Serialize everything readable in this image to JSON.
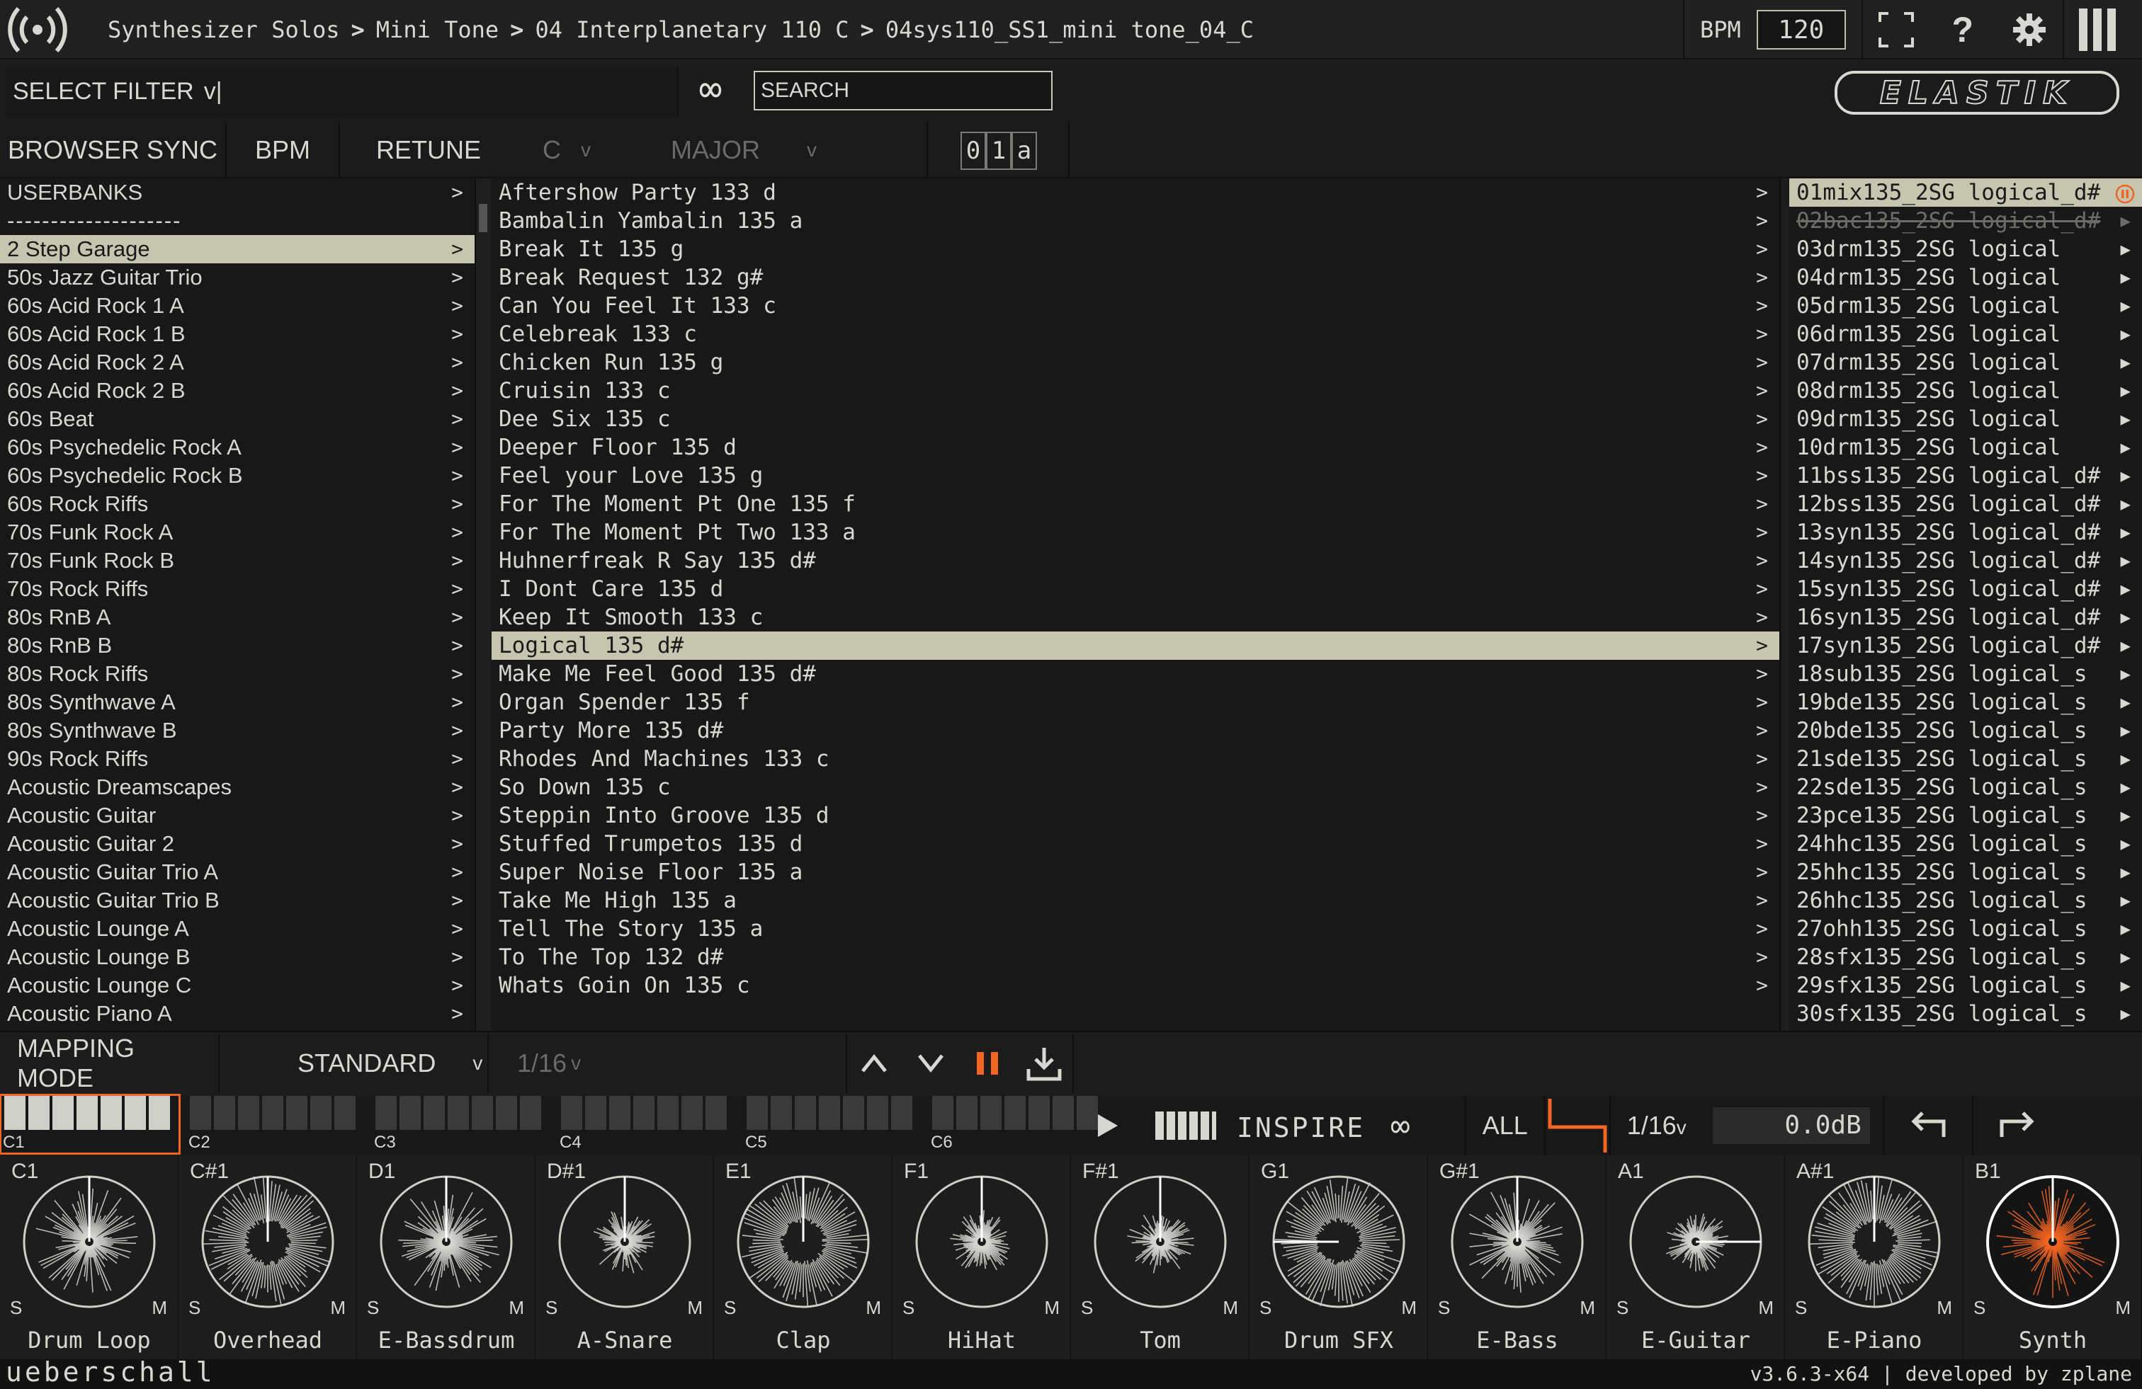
{
  "topbar": {
    "breadcrumb": [
      "Synthesizer Solos",
      "Mini Tone",
      "04 Interplanetary 110 C",
      "04sys110_SS1_mini tone_04_C"
    ],
    "separator": ">",
    "bpm_label": "BPM",
    "bpm_value": "120",
    "icons": [
      "broadcast-icon",
      "fullscreen-icon",
      "help-icon",
      "gear-icon",
      "columns-icon"
    ],
    "help_glyph": "?"
  },
  "filter": {
    "label": "SELECT FILTER",
    "caret": "v|",
    "search_placeholder": "SEARCH",
    "loop_glyph": "∞",
    "logo_text": "ELASTIK"
  },
  "options": {
    "browser_sync": "BROWSER SYNC",
    "bpm": "BPM",
    "retune": "RETUNE",
    "key": "C",
    "key_caret": "v",
    "scale": "MAJOR",
    "scale_caret": "v",
    "sort_keys": [
      "0",
      "1",
      "a"
    ]
  },
  "banks": {
    "header": "USERBANKS",
    "divider": "--------------------",
    "items": [
      "2 Step Garage",
      "50s Jazz Guitar Trio",
      "60s Acid Rock 1 A",
      "60s Acid Rock 1 B",
      "60s Acid Rock 2 A",
      "60s Acid Rock 2 B",
      "60s Beat",
      "60s Psychedelic Rock A",
      "60s Psychedelic Rock B",
      "60s Rock Riffs",
      "70s Funk Rock A",
      "70s Funk Rock B",
      "70s Rock Riffs",
      "80s RnB A",
      "80s RnB B",
      "80s Rock Riffs",
      "80s Synthwave A",
      "80s Synthwave B",
      "90s Rock Riffs",
      "Acoustic Dreamscapes",
      "Acoustic Guitar",
      "Acoustic Guitar 2",
      "Acoustic Guitar Trio A",
      "Acoustic Guitar Trio B",
      "Acoustic Lounge A",
      "Acoustic Lounge B",
      "Acoustic Lounge C",
      "Acoustic Piano A"
    ],
    "selected": 0
  },
  "songs": {
    "items": [
      "Aftershow Party 133 d",
      "Bambalin Yambalin 135 a",
      "Break It 135 g",
      "Break Request 132 g#",
      "Can You Feel It 133 c",
      "Celebreak 133 c",
      "Chicken Run 135 g",
      "Cruisin 133 c",
      "Dee Six 135 c",
      "Deeper Floor 135 d",
      "Feel your Love 135 g",
      "For The Moment Pt One 135 f",
      "For The Moment Pt Two 133 a",
      "Huhnerfreak R Say 135 d#",
      "I Dont Care 135 d",
      "Keep It Smooth 133 c",
      "Logical 135 d#",
      "Make Me Feel Good 135 d#",
      "Organ Spender 135 f",
      "Party More 135 d#",
      "Rhodes And Machines 133 c",
      "So Down 135 c",
      "Steppin Into Groove 135 d",
      "Stuffed Trumpetos 135 d",
      "Super Noise Floor 135 a",
      "Take Me High 135 a",
      "Tell The Story 135 a",
      "To The Top 132 d#",
      "Whats Goin On 135 c"
    ],
    "selected": 16
  },
  "files": {
    "items": [
      "01mix135_2SG logical_d#",
      "02bac135_2SG logical_d#",
      "03drm135_2SG logical",
      "04drm135_2SG logical",
      "05drm135_2SG logical",
      "06drm135_2SG logical",
      "07drm135_2SG logical",
      "08drm135_2SG logical",
      "09drm135_2SG logical",
      "10drm135_2SG logical",
      "11bss135_2SG logical_d#",
      "12bss135_2SG logical_d#",
      "13syn135_2SG logical_d#",
      "14syn135_2SG logical_d#",
      "15syn135_2SG logical_d#",
      "16syn135_2SG logical_d#",
      "17syn135_2SG logical_d#",
      "18sub135_2SG logical_s",
      "19bde135_2SG logical_s",
      "20bde135_2SG logical_s",
      "21sde135_2SG logical_s",
      "22sde135_2SG logical_s",
      "23pce135_2SG logical_s",
      "24hhc135_2SG logical_s",
      "25hhc135_2SG logical_s",
      "26hhc135_2SG logical_s",
      "27ohh135_2SG logical_s",
      "28sfx135_2SG logical_s",
      "29sfx135_2SG logical_s",
      "30sfx135_2SG logical_s"
    ],
    "selected": 0,
    "dimmed": 1,
    "pause_glyph": "II"
  },
  "mapping": {
    "label": "MAPPING MODE",
    "mode": "STANDARD",
    "mode_caret": "v",
    "quant": "1/16",
    "quant_caret": "v"
  },
  "keyboard": {
    "octaves": [
      "C1",
      "C2",
      "C3",
      "C4",
      "C5",
      "C6"
    ]
  },
  "transport": {
    "inspire": "INSPIRE",
    "loop_glyph": "∞",
    "all": "ALL",
    "quant": "1/16",
    "quant_caret": "v",
    "gain": "0.0dB"
  },
  "pads": [
    {
      "note": "C1",
      "name": "Drum Loop"
    },
    {
      "note": "C#1",
      "name": "Overhead"
    },
    {
      "note": "D1",
      "name": "E-Bassdrum"
    },
    {
      "note": "D#1",
      "name": "A-Snare"
    },
    {
      "note": "E1",
      "name": "Clap"
    },
    {
      "note": "F1",
      "name": "HiHat"
    },
    {
      "note": "F#1",
      "name": "Tom"
    },
    {
      "note": "G1",
      "name": "Drum SFX"
    },
    {
      "note": "G#1",
      "name": "E-Bass"
    },
    {
      "note": "A1",
      "name": "E-Guitar"
    },
    {
      "note": "A#1",
      "name": "E-Piano"
    },
    {
      "note": "B1",
      "name": "Synth"
    }
  ],
  "pad_solo": "S",
  "pad_mute": "M",
  "footer": {
    "brand": "ueberschall",
    "version": "v3.6.3-x64 | developed by zplane"
  },
  "colors": {
    "accent": "#f26522",
    "selection": "#c6c5b0",
    "background": "#1d1d1d",
    "text": "#d8d8d2"
  }
}
